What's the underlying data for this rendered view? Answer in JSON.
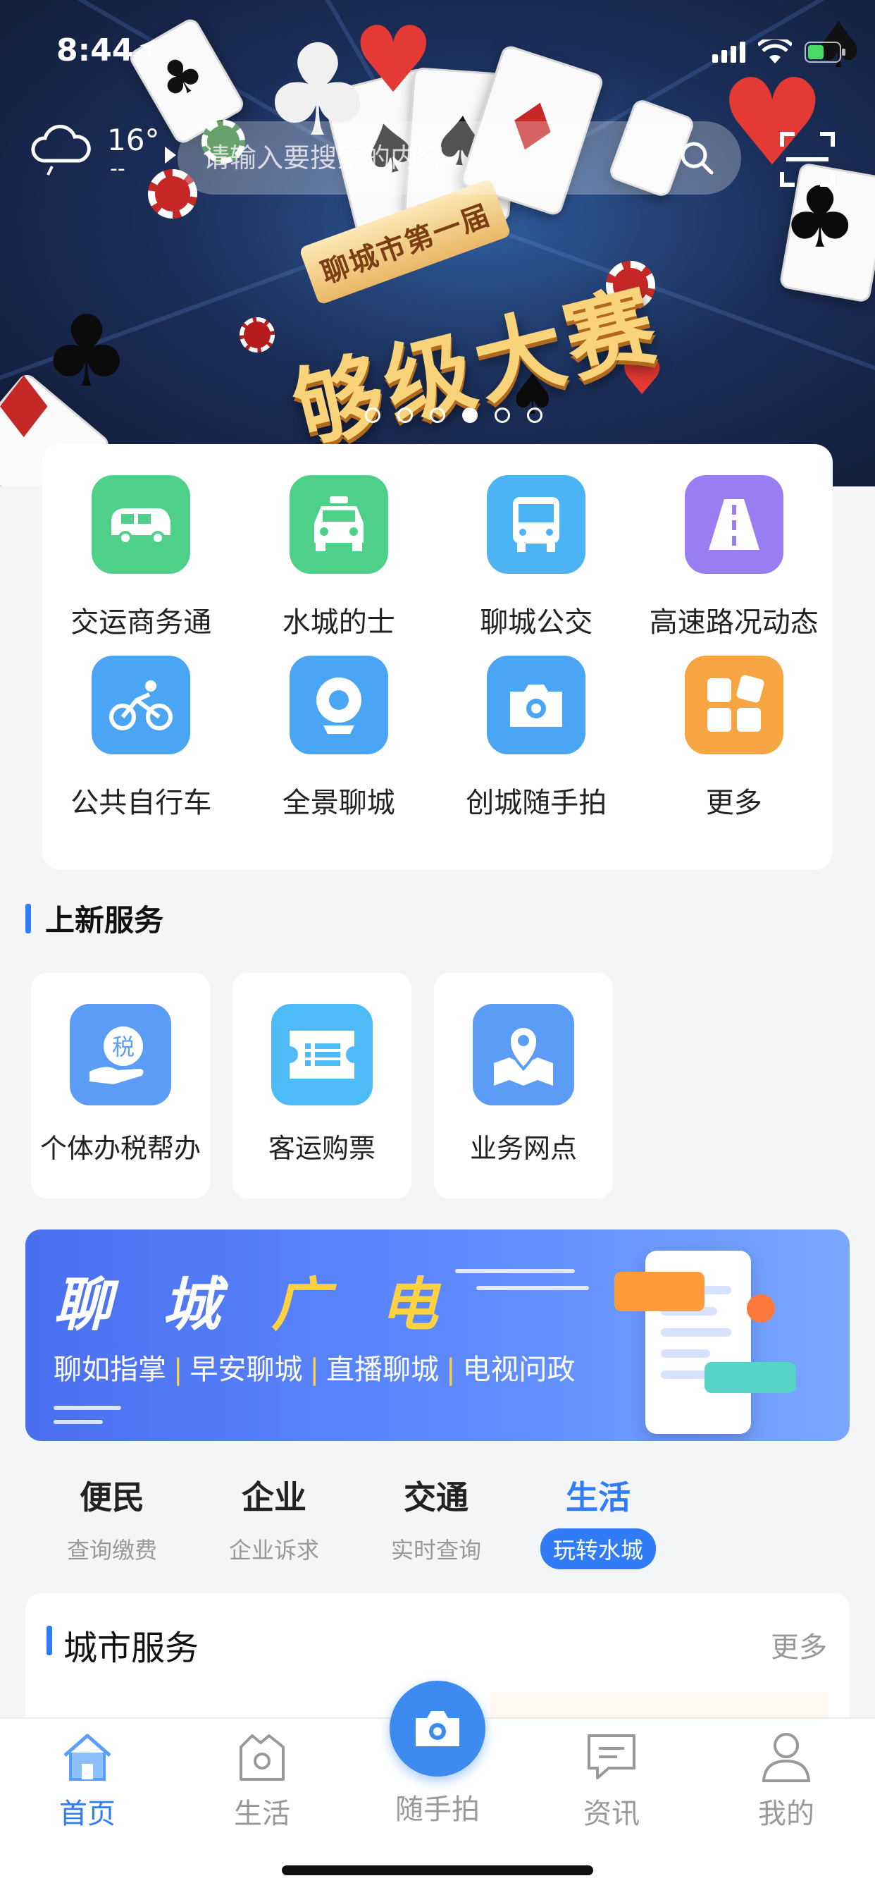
{
  "status_bar": {
    "time": "8:44"
  },
  "header": {
    "temperature": "16°",
    "temp_sub": "--",
    "search_placeholder": "请输入要搜索的内容",
    "banner": {
      "ribbon": "聊城市第一届",
      "headline": "够级大赛",
      "pages": 6,
      "active_page": 4
    }
  },
  "quick_services": [
    {
      "label": "交运商务通",
      "icon": "van-icon",
      "color": "#4fd08a"
    },
    {
      "label": "水城的士",
      "icon": "taxi-icon",
      "color": "#4fd08a"
    },
    {
      "label": "聊城公交",
      "icon": "bus-icon",
      "color": "#4cb4f4"
    },
    {
      "label": "高速路况动态",
      "icon": "highway-icon",
      "color": "#9a7df2"
    },
    {
      "label": "公共自行车",
      "icon": "bicycle-icon",
      "color": "#4aa6f5"
    },
    {
      "label": "全景聊城",
      "icon": "webcam-icon",
      "color": "#4aa6f5"
    },
    {
      "label": "创城随手拍",
      "icon": "camera-icon",
      "color": "#4aa6f5"
    },
    {
      "label": "更多",
      "icon": "more-grid-icon",
      "color": "#f7a442"
    }
  ],
  "new_services": {
    "title": "上新服务",
    "items": [
      {
        "label": "个体办税帮办",
        "icon": "tax-hand-icon"
      },
      {
        "label": "客运购票",
        "icon": "ticket-icon"
      },
      {
        "label": "业务网点",
        "icon": "map-pin-icon"
      }
    ]
  },
  "promo_banner": {
    "title_a": "聊 城",
    "title_b": "广 电",
    "items": [
      "聊如指掌",
      "早安聊城",
      "直播聊城",
      "电视问政"
    ]
  },
  "category_tabs": [
    {
      "title": "便民",
      "sub": "查询缴费",
      "active": false
    },
    {
      "title": "企业",
      "sub": "企业诉求",
      "active": false
    },
    {
      "title": "交通",
      "sub": "实时查询",
      "active": false
    },
    {
      "title": "生活",
      "sub": "玩转水城",
      "active": true
    }
  ],
  "city_service": {
    "title": "城市服务",
    "more": "更多"
  },
  "tabbar": {
    "items": [
      {
        "label": "首页",
        "icon": "home-icon",
        "active": true
      },
      {
        "label": "生活",
        "icon": "life-bag-icon",
        "active": false
      },
      {
        "label": "随手拍",
        "icon": "camera-icon",
        "active": false
      },
      {
        "label": "资讯",
        "icon": "chat-news-icon",
        "active": false
      },
      {
        "label": "我的",
        "icon": "user-icon",
        "active": false
      }
    ]
  },
  "colors": {
    "accent": "#2f7cf6",
    "background": "#f4f5f7"
  }
}
